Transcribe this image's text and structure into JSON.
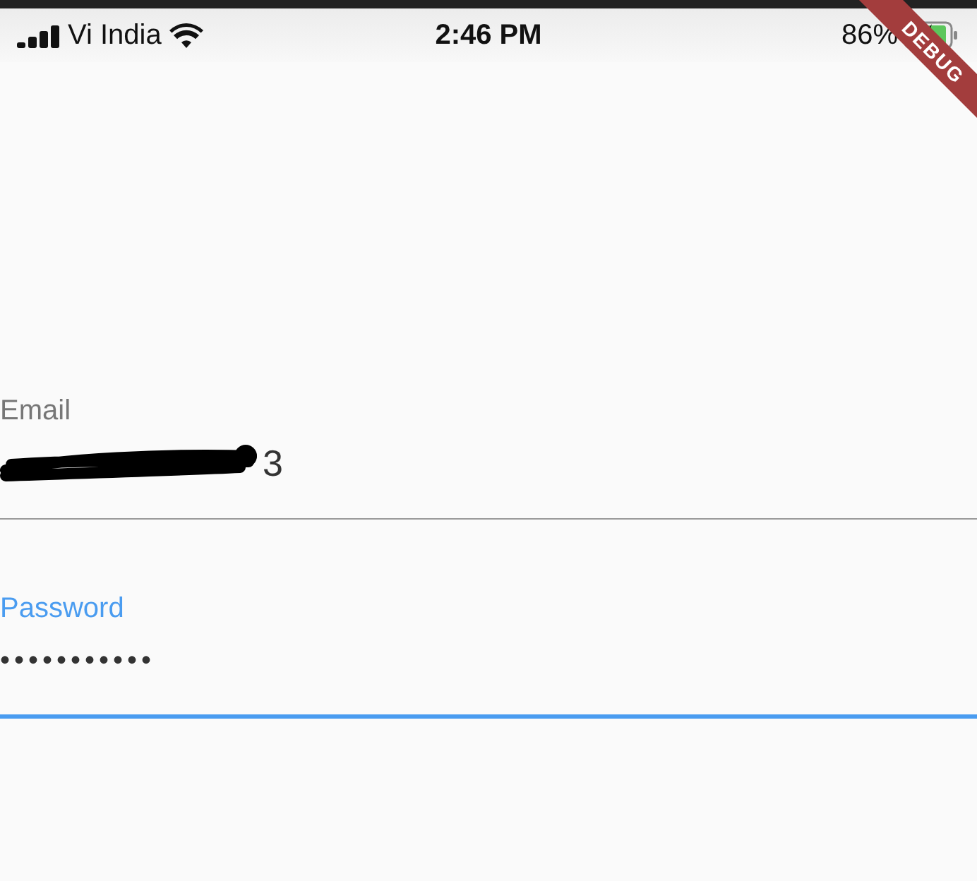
{
  "status_bar": {
    "carrier": "Vi India",
    "time": "2:46 PM",
    "battery": "86%"
  },
  "debug_banner": "DEBUG",
  "fields": [
    {
      "label": "Email",
      "value": "3",
      "obscured": false,
      "redacted": true,
      "focused": false
    },
    {
      "label": "Password",
      "value": "•••••••••••",
      "obscured": true,
      "redacted": false,
      "focused": true
    }
  ]
}
